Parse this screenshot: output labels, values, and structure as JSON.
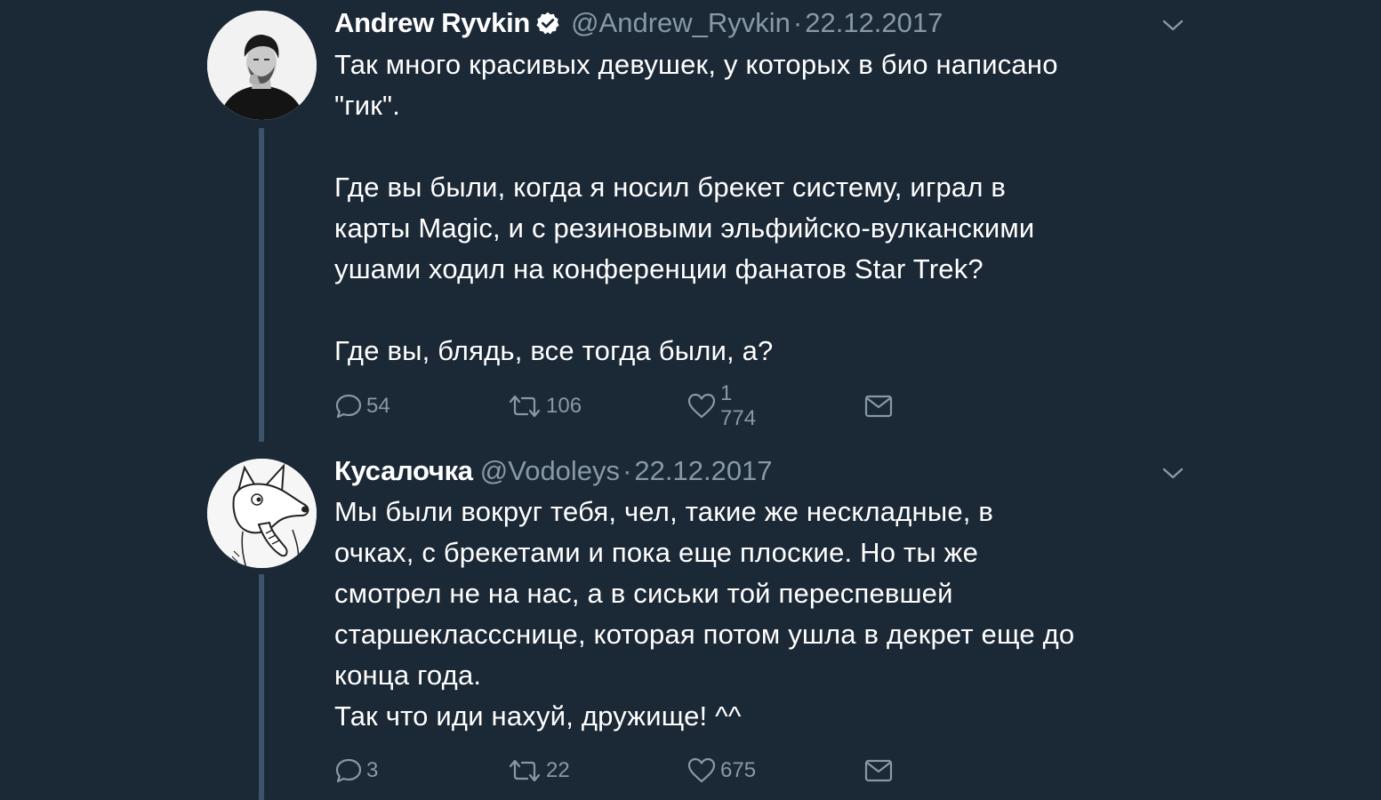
{
  "colors": {
    "background": "#1b2836",
    "text": "#ffffff",
    "secondary": "#8899a6",
    "thread_line": "#3d5468"
  },
  "tweets": [
    {
      "name": "Andrew Ryvkin",
      "verified": true,
      "handle": "@Andrew_Ryvkin",
      "separator": "·",
      "date": "22.12.2017",
      "text": "Так много красивых девушек, у которых в био написано\n\"гик\".\n\nГде вы были, когда я носил брекет систему, играл в\nкарты Magic, и с резиновыми эльфийско-вулканскими\nушами ходил на конференции фанатов Star Trek?\n\nГде вы, блядь, все тогда были, а?",
      "replies": "54",
      "retweets": "106",
      "likes": "1 774",
      "icons": [
        "avatar",
        "verified-badge-icon",
        "chevron-down-icon",
        "reply-icon",
        "retweet-icon",
        "heart-icon",
        "envelope-icon"
      ]
    },
    {
      "name": "Кусалочка",
      "verified": false,
      "handle": "@Vodoleys",
      "separator": "·",
      "date": "22.12.2017",
      "text": "Мы были вокруг тебя, чел, такие же нескладные, в\nочках, с брекетами и пока еще плоские. Но ты же\nсмотрел не на нас, а в сиськи той переспевшей\nстаршеклассснице, которая потом ушла в декрет еще до\nконца года.\nТак что иди нахуй, дружище! ^^",
      "replies": "3",
      "retweets": "22",
      "likes": "675",
      "icons": [
        "avatar",
        "chevron-down-icon",
        "reply-icon",
        "retweet-icon",
        "heart-icon",
        "envelope-icon"
      ]
    }
  ]
}
